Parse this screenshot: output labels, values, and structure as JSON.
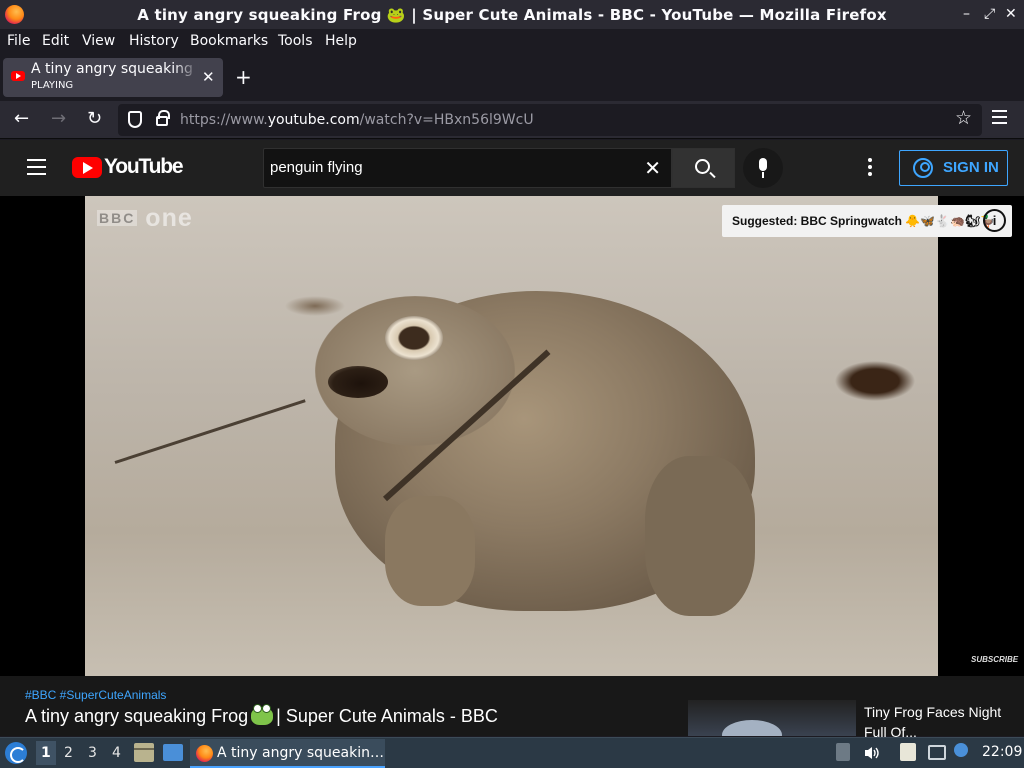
{
  "window": {
    "title": "A tiny angry squeaking Frog 🐸 | Super Cute Animals - BBC - YouTube — Mozilla Firefox",
    "minimize": "–",
    "maximize": "⤢",
    "close": "✕"
  },
  "menu": [
    "File",
    "Edit",
    "View",
    "History",
    "Bookmarks",
    "Tools",
    "Help"
  ],
  "tab": {
    "label": "A tiny angry squeaking Frog",
    "status": "PLAYING",
    "close": "✕",
    "new_tab": "+"
  },
  "nav": {
    "back": "←",
    "forward": "→",
    "reload": "↻",
    "url_prefix": "https://www.",
    "url_host": "youtube.com",
    "url_path": "/watch?v=HBxn56l9WcU",
    "bookmark_star": "☆"
  },
  "youtube": {
    "logo_text": "YouTube",
    "search_value": "penguin flying",
    "search_clear": "✕",
    "sign_in": "SIGN IN"
  },
  "video": {
    "watermark": "one",
    "watermark_bbc": "BBC",
    "suggested": "Suggested: BBC Springwatch 🐥🦋🐇🦔🐿🦆",
    "info": "i",
    "subscribe": "SUBSCRIBE"
  },
  "below": {
    "hashtags": "#BBC #SuperCuteAnimals",
    "title_part1": "A tiny angry squeaking Frog",
    "title_part2": "| Super Cute Animals - BBC",
    "related_title": "Tiny Frog Faces Night Full Of..."
  },
  "taskbar": {
    "workspaces": [
      "1",
      "2",
      "3",
      "4"
    ],
    "active_task": "A tiny angry squeakin…",
    "clock": "22:09"
  },
  "colors": {
    "yt_red": "#ff0000",
    "link_blue": "#3ea6ff"
  }
}
